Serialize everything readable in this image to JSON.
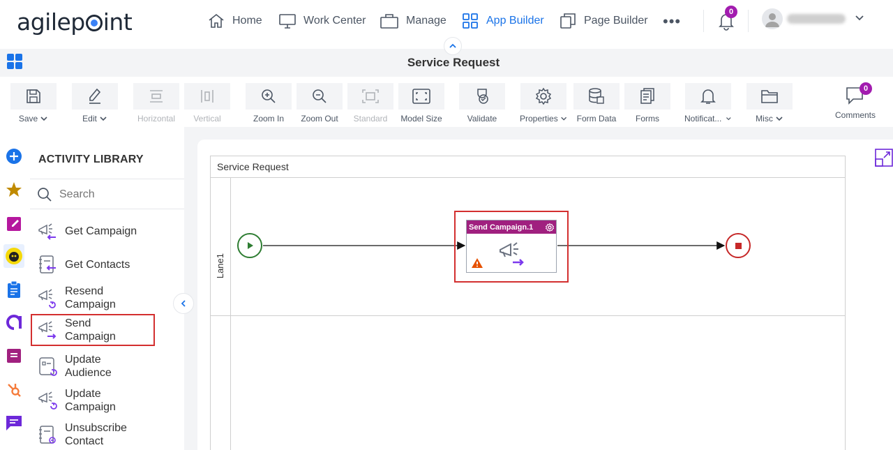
{
  "app": {
    "logo_text_a": "agilep",
    "logo_text_b": "int"
  },
  "nav": {
    "home": "Home",
    "work_center": "Work Center",
    "manage": "Manage",
    "app_builder": "App Builder",
    "page_builder": "Page Builder",
    "more": "•••",
    "notifications_count": "0"
  },
  "titlebar": {
    "title": "Service Request"
  },
  "toolbar": {
    "save": "Save",
    "edit": "Edit",
    "horizontal": "Horizontal",
    "vertical": "Vertical",
    "zoom_in": "Zoom In",
    "zoom_out": "Zoom Out",
    "standard": "Standard",
    "model_size": "Model Size",
    "validate": "Validate",
    "properties": "Properties",
    "form_data": "Form Data",
    "forms": "Forms",
    "notifications": "Notificat...",
    "misc": "Misc",
    "comments": "Comments",
    "comments_count": "0"
  },
  "library": {
    "title": "ACTIVITY LIBRARY",
    "search_placeholder": "Search",
    "items": [
      {
        "label": "Get Campaign"
      },
      {
        "label": "Get Contacts"
      },
      {
        "label": "Resend Campaign"
      },
      {
        "label": "Send Campaign"
      },
      {
        "label": "Update Audience"
      },
      {
        "label": "Update Campaign"
      },
      {
        "label": "Unsubscribe Contact"
      }
    ]
  },
  "canvas": {
    "pool_title": "Service Request",
    "lane_label": "Lane1",
    "activity_title": "Send Campaign.1"
  },
  "colors": {
    "accent": "#1a73e8",
    "activity_header": "#a0207f",
    "badge": "#a21caf",
    "highlight": "#d32f2f",
    "start": "#2e7d32",
    "end": "#c62828"
  }
}
